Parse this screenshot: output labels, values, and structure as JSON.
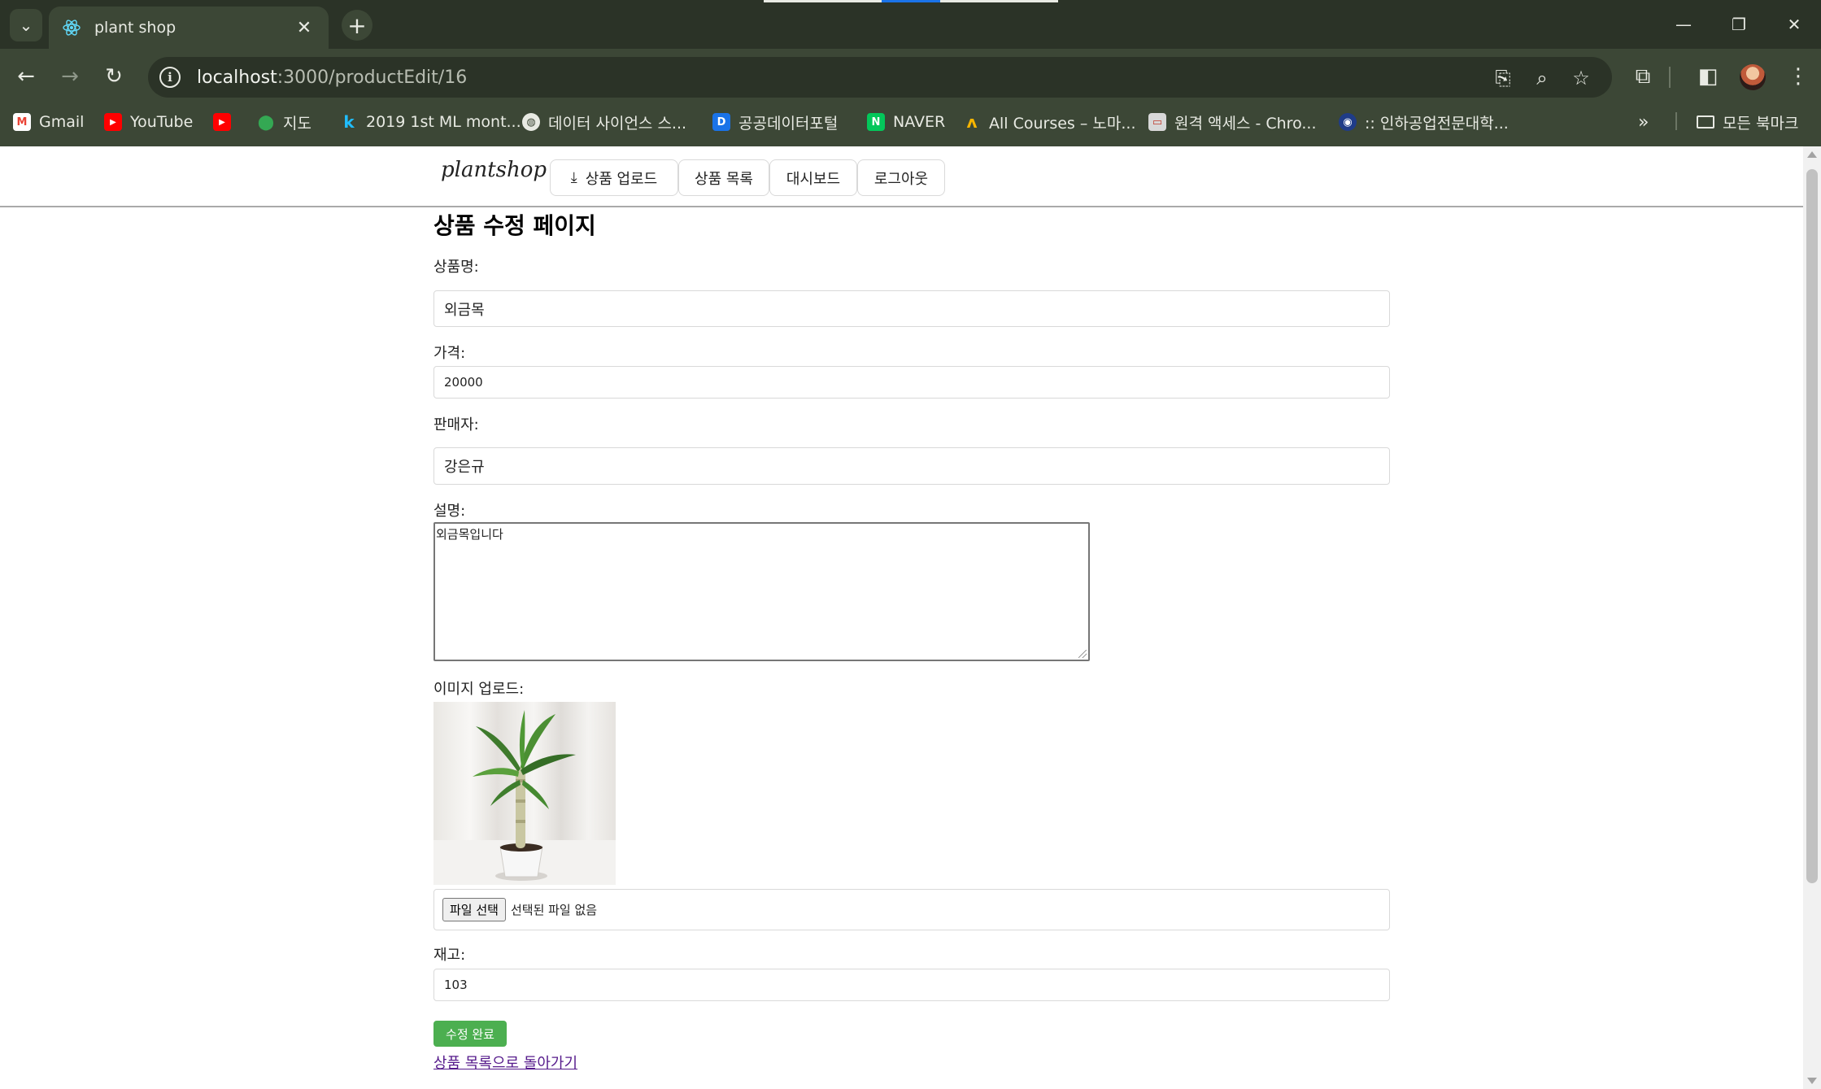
{
  "browser": {
    "tab_title": "plant shop",
    "url_host": "localhost",
    "url_path": ":3000/productEdit/16",
    "bookmarks": [
      {
        "label": "Gmail",
        "icon": "gmail-icon"
      },
      {
        "label": "YouTube",
        "icon": "youtube-icon"
      },
      {
        "label": "",
        "icon": "youtube-icon"
      },
      {
        "label": "지도",
        "icon": "maps-icon"
      },
      {
        "label": "2019 1st ML mont...",
        "icon": "k-icon"
      },
      {
        "label": "데이터 사이언스 스...",
        "icon": "globe-icon"
      },
      {
        "label": "공공데이터포털",
        "icon": "data-portal-icon"
      },
      {
        "label": "NAVER",
        "icon": "naver-icon"
      },
      {
        "label": "All Courses – 노마...",
        "icon": "nomad-icon"
      },
      {
        "label": "원격 액세스 - Chro...",
        "icon": "remote-icon"
      },
      {
        "label": ":: 인하공업전문대학...",
        "icon": "school-icon"
      }
    ],
    "all_bookmarks_label": "모든 북마크",
    "colors": {
      "frame": "#2b3327",
      "toolbar": "#3c4736"
    }
  },
  "header": {
    "logo_text": "plantshop",
    "nav": {
      "upload": "상품 업로드",
      "list": "상품 목록",
      "dashboard": "대시보드",
      "logout": "로그아웃"
    }
  },
  "form": {
    "title": "상품 수정 페이지",
    "name_label": "상품명:",
    "name_value": "외금목",
    "price_label": "가격:",
    "price_value": "20000",
    "seller_label": "판매자:",
    "seller_value": "강은규",
    "description_label": "설명:",
    "description_value": "외금목입니다",
    "image_label": "이미지 업로드:",
    "file_button": "파일 선택",
    "file_status": "선택된 파일 없음",
    "stock_label": "재고:",
    "stock_value": "103",
    "submit_label": "수정 완료",
    "back_link": "상품 목록으로 돌아가기",
    "colors": {
      "submit": "#4caf50",
      "link": "#551a8b"
    }
  }
}
